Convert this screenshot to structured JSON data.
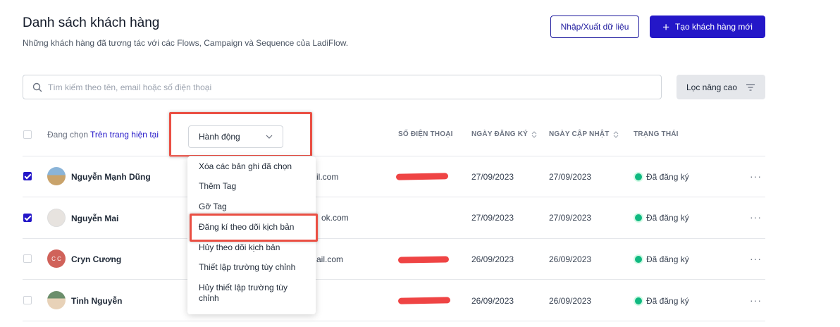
{
  "header": {
    "title": "Danh sách khách hàng",
    "subtitle": "Những khách hàng đã tương tác với các Flows, Campaign và Sequence của LadiFlow.",
    "import_export_label": "Nhập/Xuất dữ liệu",
    "create_plus": "+",
    "create_label": "Tạo khách hàng mới"
  },
  "search": {
    "placeholder": "Tìm kiếm theo tên, email hoặc số điện thoại",
    "value": ""
  },
  "filter": {
    "label": "Lọc nâng cao"
  },
  "bulk": {
    "selecting_label": "Đang chọn",
    "scope_label": "Trên trang hiện tại",
    "action_label": "Hành động"
  },
  "columns": {
    "phone": "SỐ ĐIỆN THOẠI",
    "registered": "NGÀY ĐĂNG KÝ",
    "updated": "NGÀY CẬP NHẬT",
    "status": "TRẠNG THÁI"
  },
  "action_menu": [
    "Xóa các bản ghi đã chọn",
    "Thêm Tag",
    "Gỡ Tag",
    "Đăng kí theo dõi kịch bản",
    "Hủy theo dõi kịch bản",
    "Thiết lập trường tùy chỉnh",
    "Hủy thiết lập trường tùy chỉnh"
  ],
  "rows": [
    {
      "name": "Nguyễn Mạnh Dũng",
      "email_visible": "il.com",
      "registered": "27/09/2023",
      "updated": "27/09/2023",
      "status": "Đã đăng ký",
      "checked": true
    },
    {
      "name": "Nguyễn Mai",
      "email_visible": "ok.com",
      "registered": "27/09/2023",
      "updated": "27/09/2023",
      "status": "Đã đăng ký",
      "checked": true
    },
    {
      "name": "Cryn Cương",
      "initials": "C C",
      "email_visible": "ail.com",
      "registered": "26/09/2023",
      "updated": "26/09/2023",
      "status": "Đã đăng ký",
      "checked": false
    },
    {
      "name": "Tinh Nguyễn",
      "email_visible": "",
      "registered": "26/09/2023",
      "updated": "26/09/2023",
      "status": "Đã đăng ký",
      "checked": false
    }
  ],
  "more_glyph": "···",
  "colors": {
    "primary": "#2417c8",
    "status_green": "#10b981",
    "highlight": "#ea4f43"
  }
}
